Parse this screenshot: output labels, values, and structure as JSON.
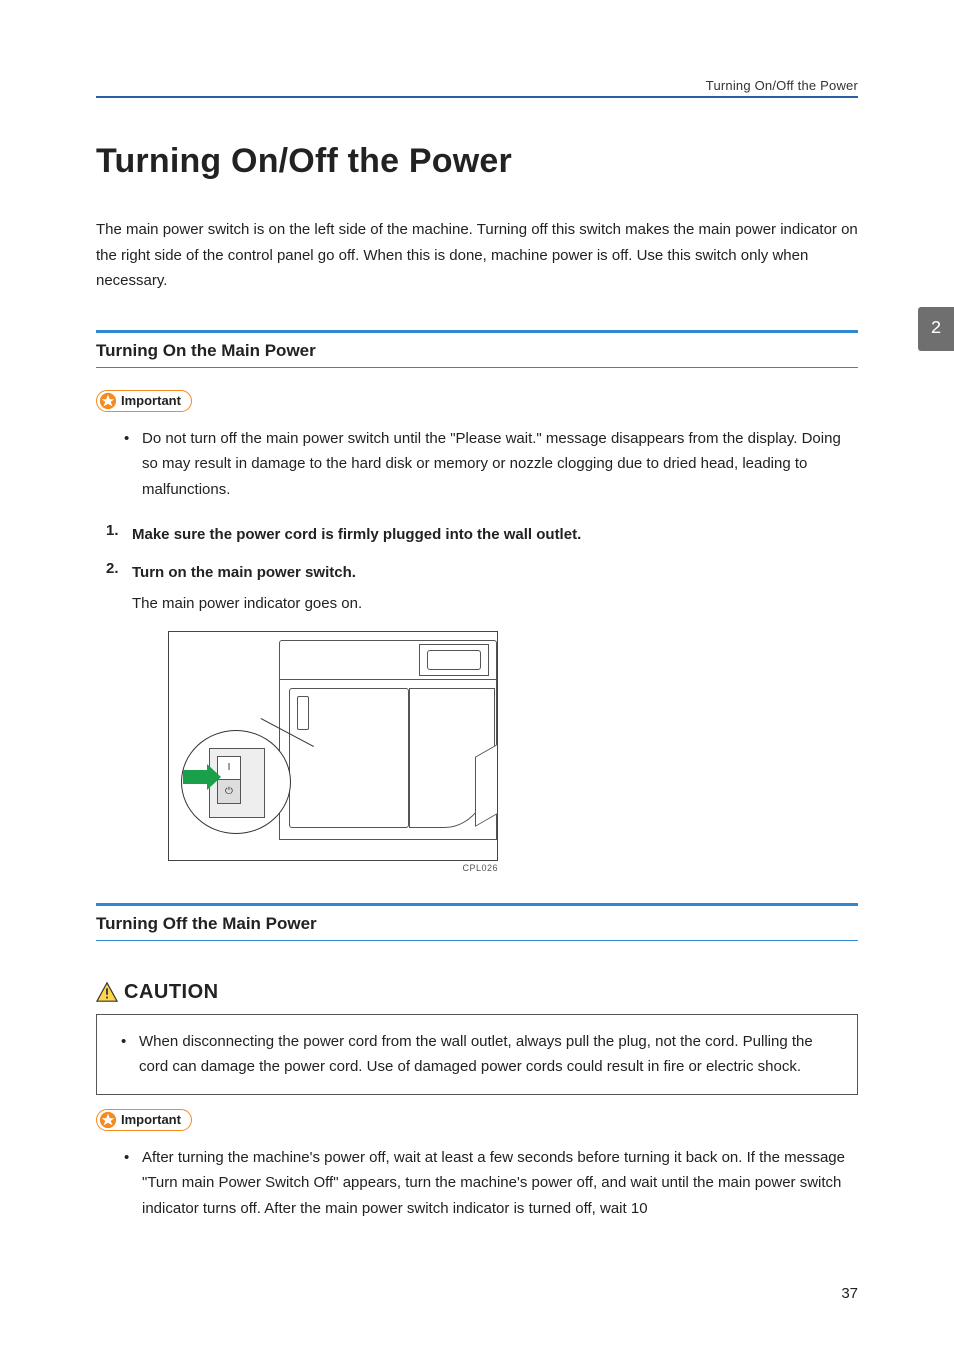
{
  "running_header": "Turning On/Off the Power",
  "side_tab": "2",
  "page_title": "Turning On/Off the Power",
  "intro": "The main power switch is on the left side of the machine. Turning off this switch makes the main power indicator on the right side of the control panel go off. When this is done, machine power is off. Use this switch only when necessary.",
  "section1": {
    "title": "Turning On the Main Power",
    "important_label": "Important",
    "important_bullets": [
      "Do not turn off the main power switch until the \"Please wait.\" message disappears from the display. Doing so may result in damage to the hard disk or memory or nozzle clogging due to dried head, leading to malfunctions."
    ],
    "steps": [
      {
        "label": "Make sure the power cord is firmly plugged into the wall outlet."
      },
      {
        "label": "Turn on the main power switch.",
        "note": "The main power indicator goes on."
      }
    ],
    "figure_alt": "Illustration of machine left side with callout of main power switch and green arrow pointing to the ON position.",
    "figure_caption": "CPL026"
  },
  "section2": {
    "title": "Turning Off the Main Power",
    "caution_label": "CAUTION",
    "caution_bullets": [
      "When disconnecting the power cord from the wall outlet, always pull the plug, not the cord. Pulling the cord can damage the power cord. Use of damaged power cords could result in fire or electric shock."
    ],
    "important_label": "Important",
    "important_bullets": [
      "After turning the machine's power off, wait at least a few seconds before turning it back on. If the message \"Turn main Power Switch Off\" appears, turn the machine's power off, and wait until the main power switch indicator turns off. After the main power switch indicator is turned off, wait 10"
    ]
  },
  "page_number": "37"
}
